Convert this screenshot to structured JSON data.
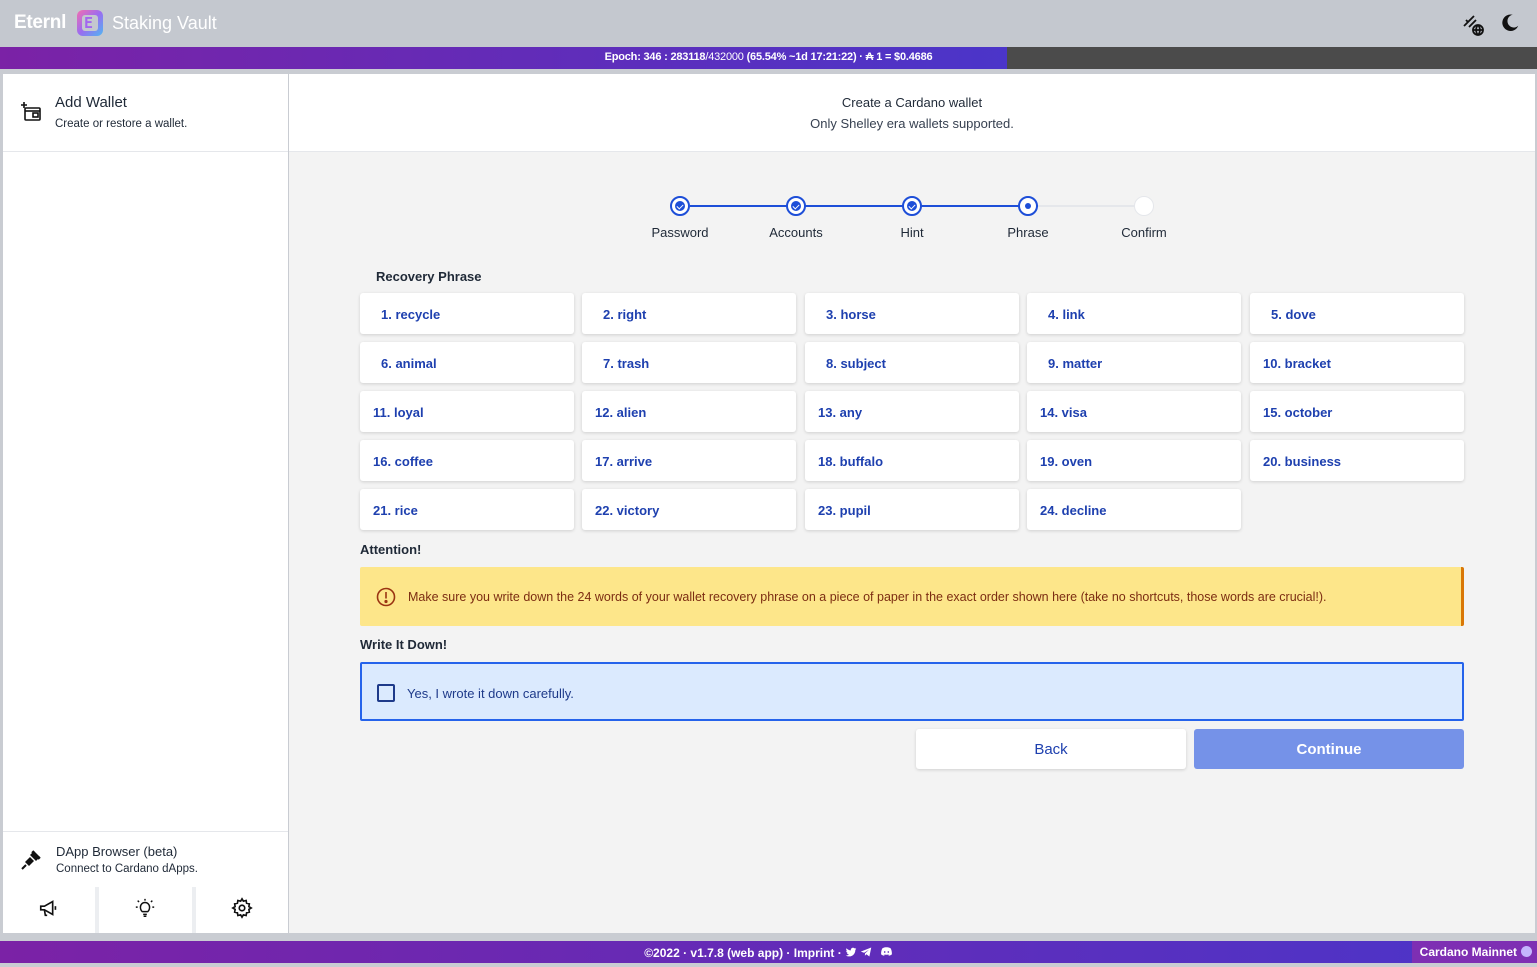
{
  "app": {
    "brand": "Eternl",
    "subtitle": "Staking Vault"
  },
  "epoch": {
    "label": "Epoch: 346 : 283118",
    "total": "/432000",
    "progress": "(65.54% ~1d 17:21:22)",
    "price": "· ₳ 1 = $0.4686",
    "fraction": 0.6554
  },
  "sidebar": {
    "add_wallet": {
      "title": "Add Wallet",
      "subtitle": "Create or restore a wallet."
    },
    "dapp": {
      "title": "DApp Browser (beta)",
      "subtitle": "Connect to Cardano dApps."
    },
    "buttons": [
      {
        "icon": "megaphone-icon"
      },
      {
        "icon": "lightbulb-icon"
      },
      {
        "icon": "gear-icon"
      }
    ]
  },
  "header": {
    "title": "Create a Cardano wallet",
    "subtitle": "Only Shelley era wallets supported."
  },
  "stepper": [
    {
      "label": "Password",
      "state": "done"
    },
    {
      "label": "Accounts",
      "state": "done"
    },
    {
      "label": "Hint",
      "state": "done"
    },
    {
      "label": "Phrase",
      "state": "active"
    },
    {
      "label": "Confirm",
      "state": "todo"
    }
  ],
  "phrase": {
    "label": "Recovery Phrase",
    "words": [
      "1. recycle",
      "2. right",
      "3. horse",
      "4. link",
      "5. dove",
      "6. animal",
      "7. trash",
      "8. subject",
      "9. matter",
      "10. bracket",
      "11. loyal",
      "12. alien",
      "13. any",
      "14. visa",
      "15. october",
      "16. coffee",
      "17. arrive",
      "18. buffalo",
      "19. oven",
      "20. business",
      "21. rice",
      "22. victory",
      "23. pupil",
      "24. decline"
    ]
  },
  "attention": {
    "label": "Attention!",
    "text": "Make sure you write down the 24 words of your wallet recovery phrase on a piece of paper in the exact order shown here (take no shortcuts, those words are crucial!)."
  },
  "write_down": {
    "label": "Write It Down!",
    "checkbox_text": "Yes, I wrote it down carefully.",
    "checked": false
  },
  "actions": {
    "back": "Back",
    "continue": "Continue"
  },
  "footer": {
    "text": "©2022 · v1.7.8 (web app) · Imprint ·",
    "network": "Cardano Mainnet"
  },
  "colors": {
    "accent": "#1d4ed8",
    "primary_disabled": "#7592e8",
    "warning_bg": "#fde68a",
    "info_bg": "#dbeafe"
  }
}
